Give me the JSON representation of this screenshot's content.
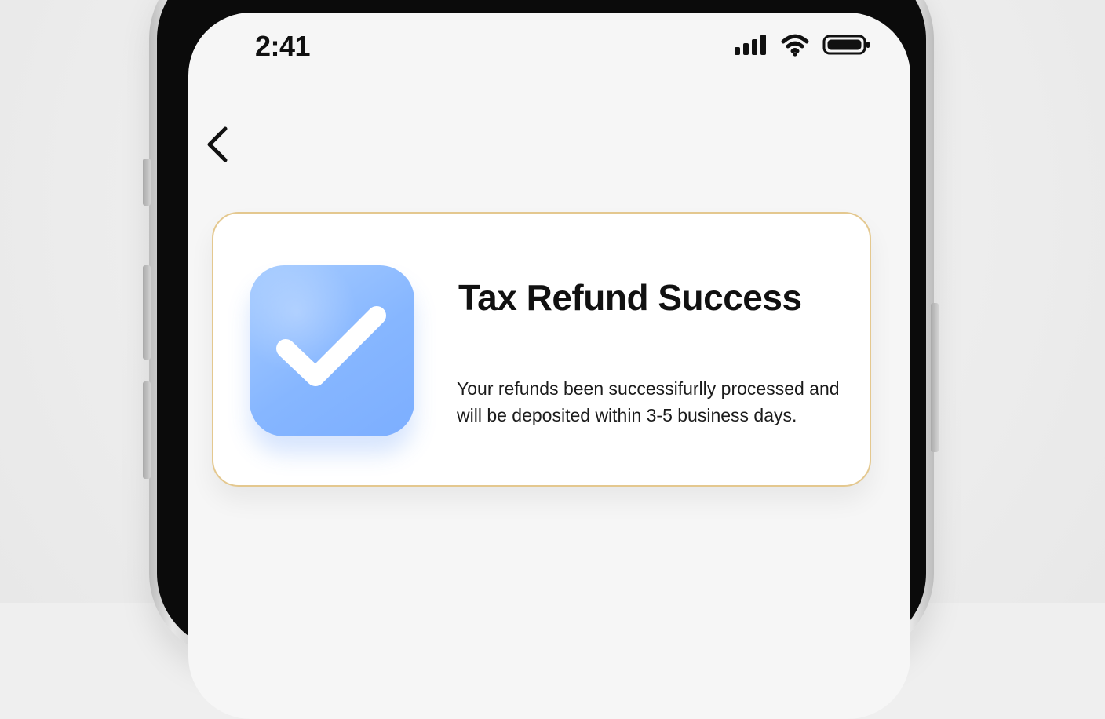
{
  "status_bar": {
    "time": "2:41",
    "icons": [
      "cellular-signal-icon",
      "wifi-icon",
      "battery-icon"
    ]
  },
  "nav": {
    "back_icon": "chevron-left-icon"
  },
  "card": {
    "icon": "checkmark-icon",
    "title": "Tax Refund Success",
    "message": "Your refunds been successifurlly processed and will be deposited within 3-5 business days."
  },
  "colors": {
    "card_border": "#e4c88f",
    "check_tile": "#86b6ff"
  }
}
